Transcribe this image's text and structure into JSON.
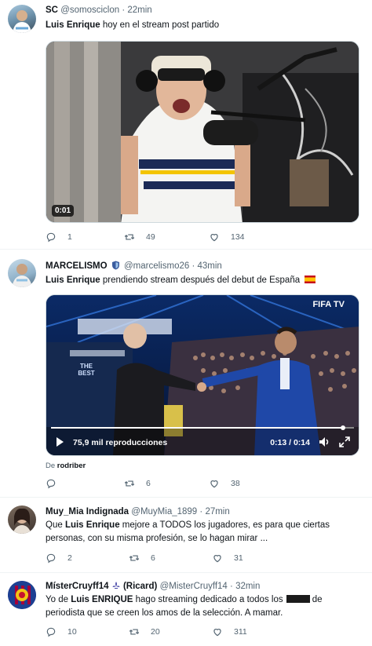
{
  "tweets": [
    {
      "name": "SC",
      "handle": "@somosciclon",
      "time": "22min",
      "text_bold": "Luis Enrique",
      "text_rest": " hoy en el stream post partido",
      "video_time": "0:01",
      "replies": "1",
      "retweets": "49",
      "likes": "134"
    },
    {
      "name": "MARCELISMO",
      "handle": "@marcelismo26",
      "time": "43min",
      "text_bold": "Luis Enrique",
      "text_rest": " prendiendo stream después del debut de España",
      "video_brand": "FIFA TV",
      "video_banner": "THE BEST",
      "views": "75,9 mil reproducciones",
      "video_time": "0:13 / 0:14",
      "from_prefix": "De ",
      "from_user": "rodriber",
      "replies": "",
      "retweets": "6",
      "likes": "38"
    },
    {
      "name": "Muy_Mia Indignada",
      "handle": "@MuyMia_1899",
      "time": "27min",
      "line1_pre": "Que ",
      "line1_bold": "Luis Enrique",
      "line1_post": " mejore a TODOS los jugadores, es para que ciertas",
      "line2": "personas, con su misma profesión, se lo hagan mirar ...",
      "replies": "2",
      "retweets": "6",
      "likes": "31"
    },
    {
      "name": "MísterCruyff14",
      "name_suffix": "(Ricard)",
      "handle": "@MisterCruyff14",
      "time": "32min",
      "line1_pre": "Yo de ",
      "line1_bold": "Luis ENRIQUE",
      "line1_post": " hago streaming dedicado a todos los",
      "line1_end": " de",
      "line2": "periodista que se creen los amos de la selección. A mamar.",
      "replies": "10",
      "retweets": "20",
      "likes": "311"
    }
  ],
  "colors": {
    "text": "#0f1419",
    "muted": "#536471",
    "border": "#eff3f4",
    "verified": "#1d9bf0"
  },
  "icons": [
    "reply-icon",
    "retweet-icon",
    "like-icon",
    "play-icon",
    "volume-icon",
    "fullscreen-icon",
    "verified-shield-icon",
    "fleur-icon",
    "spain-flag-icon"
  ]
}
